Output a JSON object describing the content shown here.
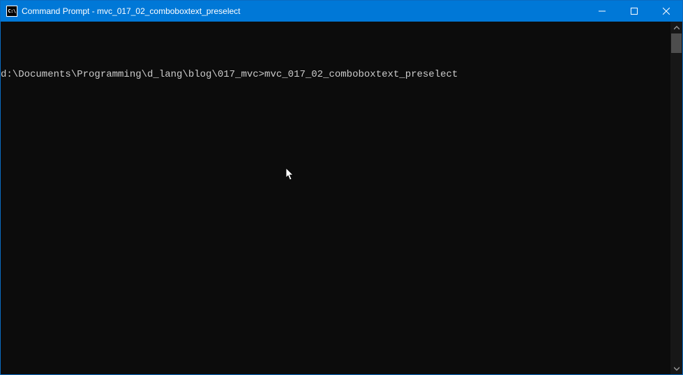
{
  "titlebar": {
    "icon_text": "C:\\",
    "title": "Command Prompt - mvc_017_02_comboboxtext_preselect"
  },
  "console": {
    "blank1": "",
    "prompt_line": "d:\\Documents\\Programming\\d_lang\\blog\\017_mvc>mvc_017_02_comboboxtext_preselect"
  }
}
